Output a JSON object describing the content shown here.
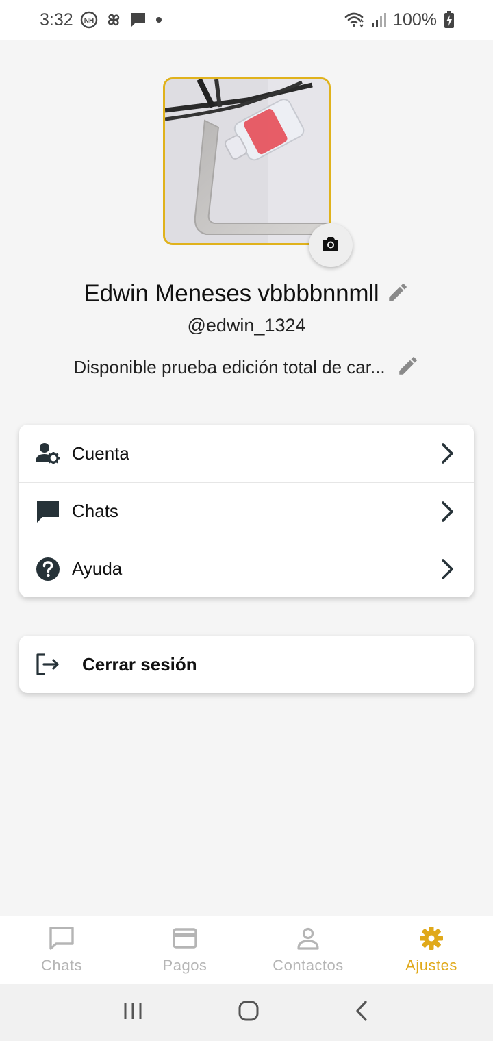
{
  "status_bar": {
    "time": "3:32",
    "battery": "100%",
    "icons_left": [
      "nh-icon",
      "pinwheel-icon",
      "message-icon",
      "dot-icon"
    ],
    "icons_right": [
      "wifi-icon",
      "signal-icon",
      "battery-charging-icon"
    ]
  },
  "profile": {
    "name": "Edwin Meneses vbbbbnnmll",
    "username": "@edwin_1324",
    "status": "Disponible prueba edición total de car...",
    "avatar_border_color": "#e0b21c"
  },
  "menu": {
    "items": [
      {
        "label": "Cuenta",
        "icon": "user-settings-icon"
      },
      {
        "label": "Chats",
        "icon": "chat-bubble-icon"
      },
      {
        "label": "Ayuda",
        "icon": "help-icon"
      }
    ]
  },
  "logout": {
    "label": "Cerrar sesión",
    "icon": "logout-icon"
  },
  "bottom_nav": {
    "active_color": "#e0a91a",
    "inactive_color": "#b5b5b5",
    "items": [
      {
        "label": "Chats",
        "icon": "chat-outline-icon",
        "active": false
      },
      {
        "label": "Pagos",
        "icon": "card-icon",
        "active": false
      },
      {
        "label": "Contactos",
        "icon": "person-icon",
        "active": false
      },
      {
        "label": "Ajustes",
        "icon": "gear-icon",
        "active": true
      }
    ]
  }
}
